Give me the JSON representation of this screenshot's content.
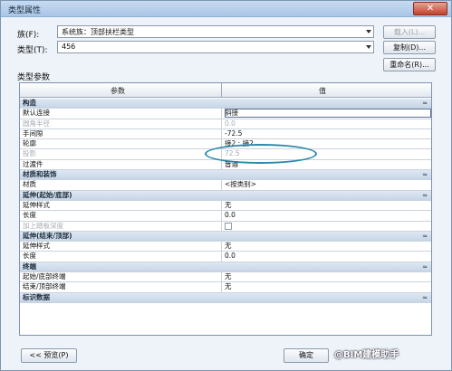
{
  "window": {
    "title": "类型属性",
    "close_glyph": "✕"
  },
  "family": {
    "label": "族(F):",
    "value": "系统族：顶部扶栏类型",
    "load_button": "载入(L)..."
  },
  "type": {
    "label": "类型(T):",
    "value": "456",
    "duplicate_button": "复制(D)...",
    "rename_button": "重命名(R)..."
  },
  "section_label": "类型参数",
  "grid": {
    "header_param": "参数",
    "header_value": "值",
    "rows": [
      {
        "kind": "group",
        "param": "构造",
        "caret": "≈"
      },
      {
        "kind": "row",
        "param": "默认连接",
        "value": "斜接",
        "selected": true
      },
      {
        "kind": "row",
        "param": "圆角半径",
        "value": "0.0",
        "grey": true
      },
      {
        "kind": "row",
        "param": "手间隙",
        "value": "-72.5"
      },
      {
        "kind": "row",
        "param": "轮廓",
        "value": "接2 : 接2"
      },
      {
        "kind": "row",
        "param": "投影",
        "value": "72.5",
        "grey": true
      },
      {
        "kind": "row",
        "param": "过渡件",
        "value": "普通"
      },
      {
        "kind": "group",
        "param": "材质和装饰",
        "caret": "≈"
      },
      {
        "kind": "row",
        "param": "材质",
        "value": "<按类别>"
      },
      {
        "kind": "group",
        "param": "延伸(起始/底部)",
        "caret": "≈"
      },
      {
        "kind": "row",
        "param": "延伸样式",
        "value": "无"
      },
      {
        "kind": "row",
        "param": "长度",
        "value": "0.0"
      },
      {
        "kind": "row",
        "param": "加上踏板深度",
        "value": "",
        "checkbox": true,
        "grey": true
      },
      {
        "kind": "group",
        "param": "延伸(结束/顶部)",
        "caret": "≈"
      },
      {
        "kind": "row",
        "param": "延伸样式",
        "value": "无"
      },
      {
        "kind": "row",
        "param": "长度",
        "value": "0.0"
      },
      {
        "kind": "group",
        "param": "终端",
        "caret": "≈"
      },
      {
        "kind": "row",
        "param": "起始/底部终端",
        "value": "无"
      },
      {
        "kind": "row",
        "param": "结束/顶部终端",
        "value": "无"
      },
      {
        "kind": "group",
        "param": "标识数据",
        "caret": "≈"
      }
    ]
  },
  "footer": {
    "preview_button": "<< 预览(P)",
    "ok_button": "确定",
    "watermark": "@BIM建模助手"
  }
}
